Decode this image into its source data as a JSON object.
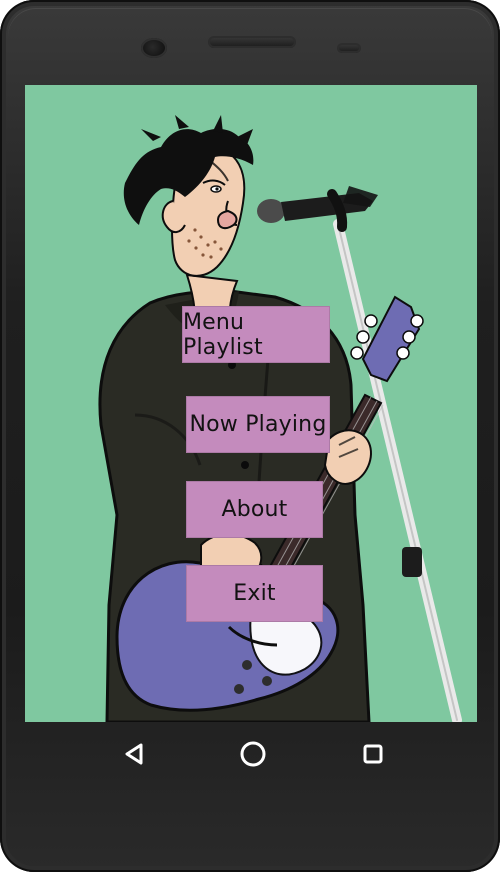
{
  "theme": {
    "screen_background": "#7fc8a0",
    "button_color": "#c48bbd",
    "nav_icon_color": "#ffffff"
  },
  "menu": {
    "items": [
      {
        "label": "Menu Playlist"
      },
      {
        "label": "Now Playing"
      },
      {
        "label": "About"
      },
      {
        "label": "Exit"
      }
    ]
  },
  "navigation": {
    "icons": [
      "back-icon",
      "home-icon",
      "recents-icon"
    ]
  }
}
